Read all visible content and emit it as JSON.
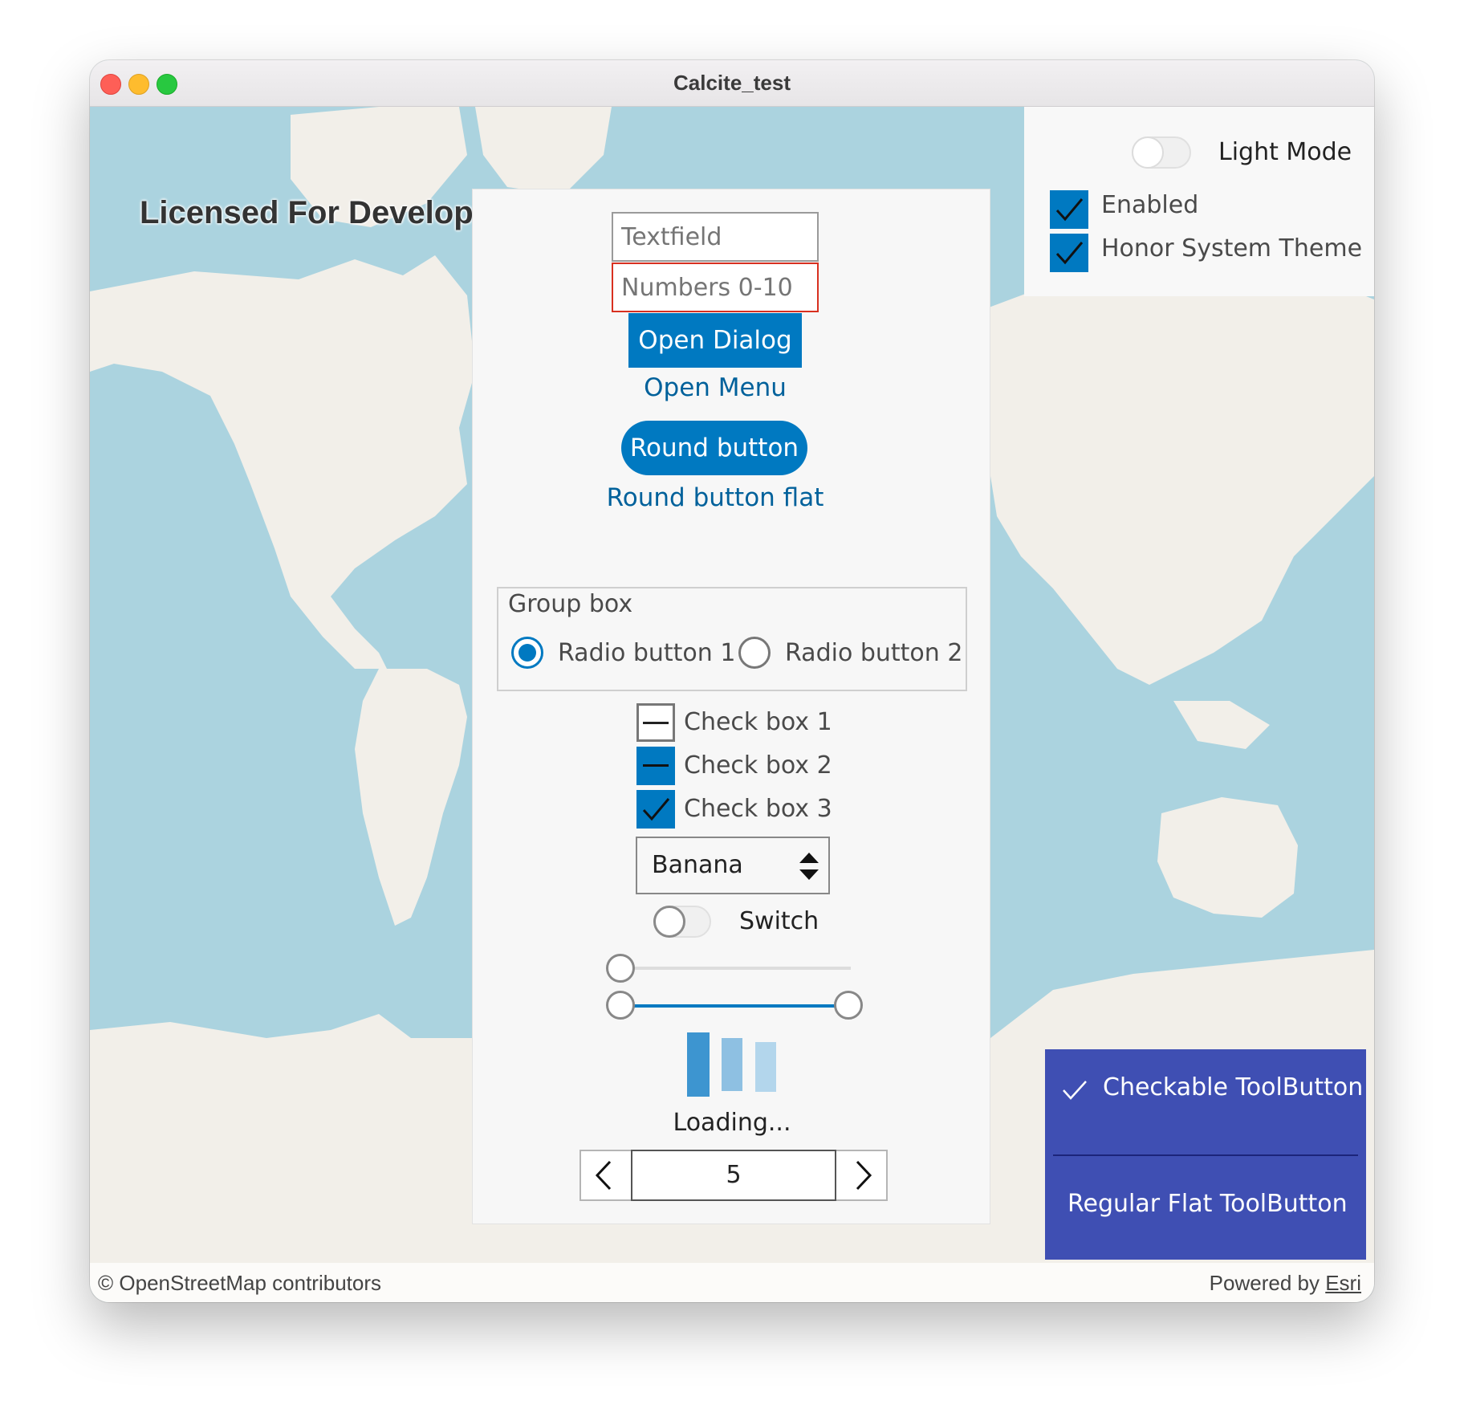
{
  "window": {
    "title": "Calcite_test"
  },
  "map": {
    "license_text": "Licensed For Developer Use Only",
    "attribution_left": "© OpenStreetMap contributors",
    "attribution_right_prefix": "Powered by",
    "attribution_right_link": "Esri"
  },
  "settings": {
    "light_mode_label": "Light Mode",
    "light_mode_on": false,
    "enabled_label": "Enabled",
    "enabled_checked": true,
    "honor_system_theme_label": "Honor System Theme",
    "honor_system_theme_checked": true
  },
  "controls": {
    "textfield_placeholder": "Textfield",
    "numbers_placeholder": "Numbers 0-10",
    "open_dialog_label": "Open Dialog",
    "open_menu_label": "Open Menu",
    "round_button_label": "Round button",
    "round_button_flat_label": "Round button flat",
    "group_box": {
      "title": "Group box",
      "radio1_label": "Radio button 1",
      "radio1_checked": true,
      "radio2_label": "Radio button 2",
      "radio2_checked": false
    },
    "checkboxes": [
      {
        "label": "Check box 1",
        "state": "partial-unfilled"
      },
      {
        "label": "Check box 2",
        "state": "partial"
      },
      {
        "label": "Check box 3",
        "state": "checked"
      }
    ],
    "combo_value": "Banana",
    "switch_label": "Switch",
    "switch_on": false,
    "slider_value": 0,
    "range_slider_values": [
      0,
      1
    ],
    "busy_indicator_label": "Loading...",
    "spinbox_value": "5"
  },
  "toolbar": {
    "checkable_label": "Checkable ToolButton",
    "checkable_checked": true,
    "regular_label": "Regular Flat ToolButton"
  },
  "colors": {
    "accent": "#0079c1",
    "ocean": "#abd3df",
    "land": "#f2efe9",
    "toolbar": "#3f4fb3",
    "error_border": "#d83020"
  },
  "icons": {
    "close": "traffic-light-red",
    "minimize": "traffic-light-yellow",
    "zoom": "traffic-light-green",
    "spin_down": "chevron-left-icon",
    "spin_up": "chevron-right-icon",
    "combo": "up-down-arrows-icon",
    "check": "check-icon"
  }
}
